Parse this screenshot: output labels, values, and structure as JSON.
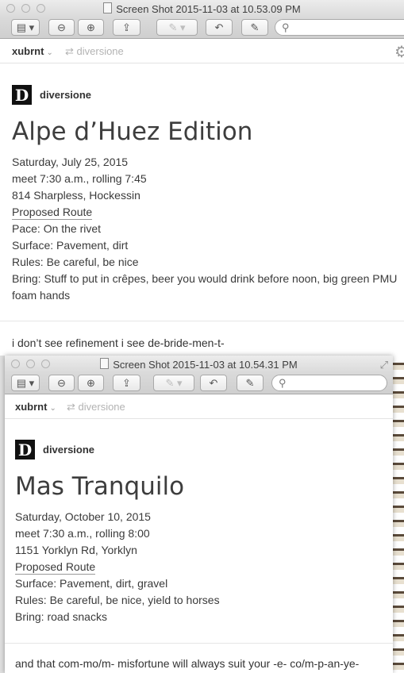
{
  "window1": {
    "title": "Screen Shot 2015-11-03 at 10.53.09 PM",
    "user": "xubrnt",
    "reblog_from": "diversione",
    "post": {
      "blog_logo": "D",
      "blog_name": "diversione",
      "title": "Alpe d’Huez Edition",
      "lines": [
        "Saturday, July 25, 2015",
        "meet 7:30 a.m., rolling 7:45",
        "814 Sharpless, Hockessin",
        "Proposed Route",
        "Pace: On the rivet",
        "Surface: Pavement, dirt",
        "Rules: Be careful, be nice",
        "Bring: Stuff to put in crêpes, beer you would drink before noon, big green PMU",
        "foam hands"
      ],
      "caption": "i don’t see refinement i see de-bride-men-t-"
    }
  },
  "window2": {
    "title": "Screen Shot 2015-11-03 at 10.54.31 PM",
    "user": "xubrnt",
    "reblog_from": "diversione",
    "post": {
      "blog_logo": "D",
      "blog_name": "diversione",
      "title": "Mas Tranquilo",
      "lines": [
        "Saturday, October 10, 2015",
        "meet 7:30 a.m., rolling 8:00",
        "1151 Yorklyn Rd, Yorklyn",
        "Proposed Route",
        "Surface: Pavement, dirt, gravel",
        "Rules: Be careful, be nice, yield to horses",
        "Bring: road snacks"
      ],
      "caption": "and that com-mo/m- misfortune will always suit your -e- co/m-p-an-ye-"
    }
  },
  "toolbar_icons": [
    "sidebar-icon",
    "zoom-out-icon",
    "zoom-in-icon",
    "share-icon",
    "markup-icon",
    "rotate-icon",
    "edit-icon",
    "search-icon"
  ],
  "colors": {
    "page_bg": "#ffffff",
    "titlebar": "#dadada",
    "text": "#3a3a3a",
    "muted": "#b3b3b3"
  }
}
